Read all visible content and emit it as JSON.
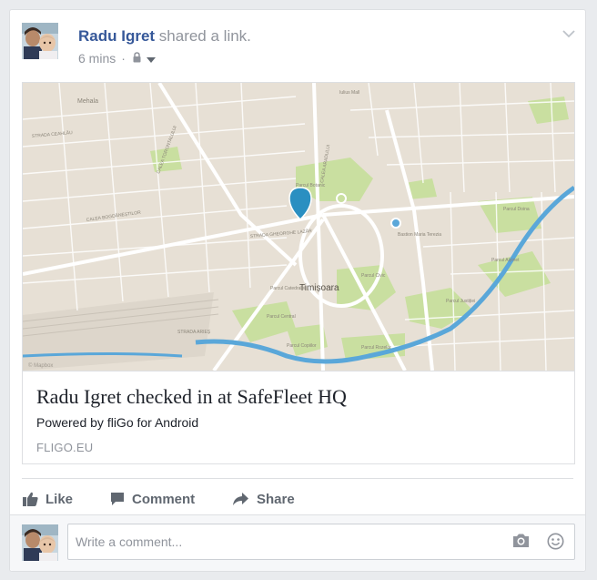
{
  "post": {
    "author_name": "Radu Igret",
    "action_text": " shared a link.",
    "timestamp": "6 mins",
    "meta_separator": "·",
    "privacy_icon": "lock-icon",
    "privacy_menu_icon": "caret-down-icon",
    "options_icon": "chevron-down-icon"
  },
  "link": {
    "title": "Radu Igret checked in at SafeFleet HQ",
    "description": "Powered by fliGo for Android",
    "domain": "FLIGO.EU",
    "map": {
      "city_label": "Timișoara",
      "marker_icon": "map-pin-icon",
      "marker_color": "#2a8fc1",
      "river_color": "#5aa7d9",
      "park_color": "#c9dfa0",
      "attribution": "© Mapbox",
      "labels": {
        "park_botanic": "Parcul Botanic",
        "bastion": "Bastion Maria Terezia",
        "parcul_central": "Parcul Central",
        "parcul_civic": "Parcul Civic",
        "parcul_rozelor": "Parcul Rozelor",
        "parcul_catedralei": "Parcul Catedralei",
        "parcul_copiilor": "Parcul Copiilor",
        "parcul_justitiei": "Parcul Justiției",
        "parcul_alpinet": "Parcul Alpinet",
        "parcul_doina": "Parcul Doina",
        "mehala": "Mehala",
        "iulius_mall": "Iulius Mall",
        "calea_torontalului": "CALEA TORONTALULUI",
        "calea_bogdanestilor": "CALEA BOGDĂNEȘTILOR",
        "calea_aradului": "CALEA ARADULUI",
        "strada_gheorghe_lazar": "STRADA GHEORGHE LAZĂR",
        "strada_ceahlau": "STRADA CEAHLĂU",
        "strada_aries": "STRADA ARIEȘ"
      }
    }
  },
  "actions": {
    "like_label": "Like",
    "like_icon": "thumbs-up-icon",
    "comment_label": "Comment",
    "comment_icon": "speech-bubble-icon",
    "share_label": "Share",
    "share_icon": "share-arrow-icon"
  },
  "comment": {
    "placeholder": "Write a comment...",
    "camera_icon": "camera-icon",
    "emoji_icon": "smiley-icon"
  },
  "colors": {
    "author_link": "#365899",
    "secondary_text": "#90949c",
    "action_text": "#606770",
    "card_border": "#dddfe2",
    "page_background": "#e9ebee"
  }
}
